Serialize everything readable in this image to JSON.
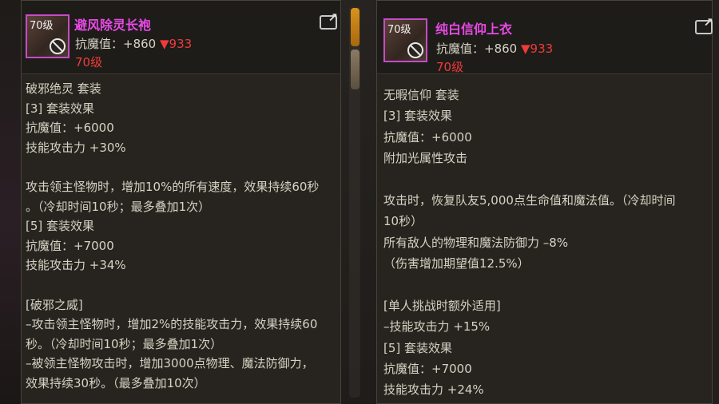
{
  "left_item": {
    "icon_level": "70级",
    "name": "避风除灵长袍",
    "stat_label": "抗魔值：+860",
    "stat_diff": "▼933",
    "level_req": "70级",
    "lines": [
      "破邪绝灵 套装",
      "[3] 套装效果",
      "抗魔值：+6000",
      "技能攻击力 +30%",
      "",
      "攻击领主怪物时，增加10%的所有速度，效果持续60秒",
      "。（冷却时间10秒；最多叠加1次）",
      "[5] 套装效果",
      "抗魔值：+7000",
      "技能攻击力 +34%",
      "",
      "[破邪之威]",
      "–攻击领主怪物时，增加2%的技能攻击力，效果持续60",
      "秒。（冷却时间10秒；最多叠加1次）",
      "–被领主怪物攻击时，增加3000点物理、魔法防御力，",
      "效果持续30秒。（最多叠加10次）"
    ]
  },
  "right_item": {
    "icon_level": "70级",
    "name": "纯白信仰上衣",
    "stat_label": "抗魔值：+860",
    "stat_diff": "▼933",
    "level_req": "70级",
    "lines": [
      "无暇信仰 套装",
      "[3] 套装效果",
      "抗魔值：+6000",
      "附加光属性攻击",
      "",
      "攻击时，恢复队友5,000点生命值和魔法值。（冷却时间",
      "10秒）",
      "所有敌人的物理和魔法防御力 –8%",
      "（伤害增加期望值12.5%）",
      "",
      "[单人挑战时额外适用]",
      "–技能攻击力 +15%",
      "[5] 套装效果",
      "抗魔值：+7000",
      "技能攻击力 +24%"
    ]
  },
  "colors": {
    "item_name": "#e84ae6",
    "negative": "#ee3b3b",
    "scroll_thumb": "#d9921c"
  }
}
